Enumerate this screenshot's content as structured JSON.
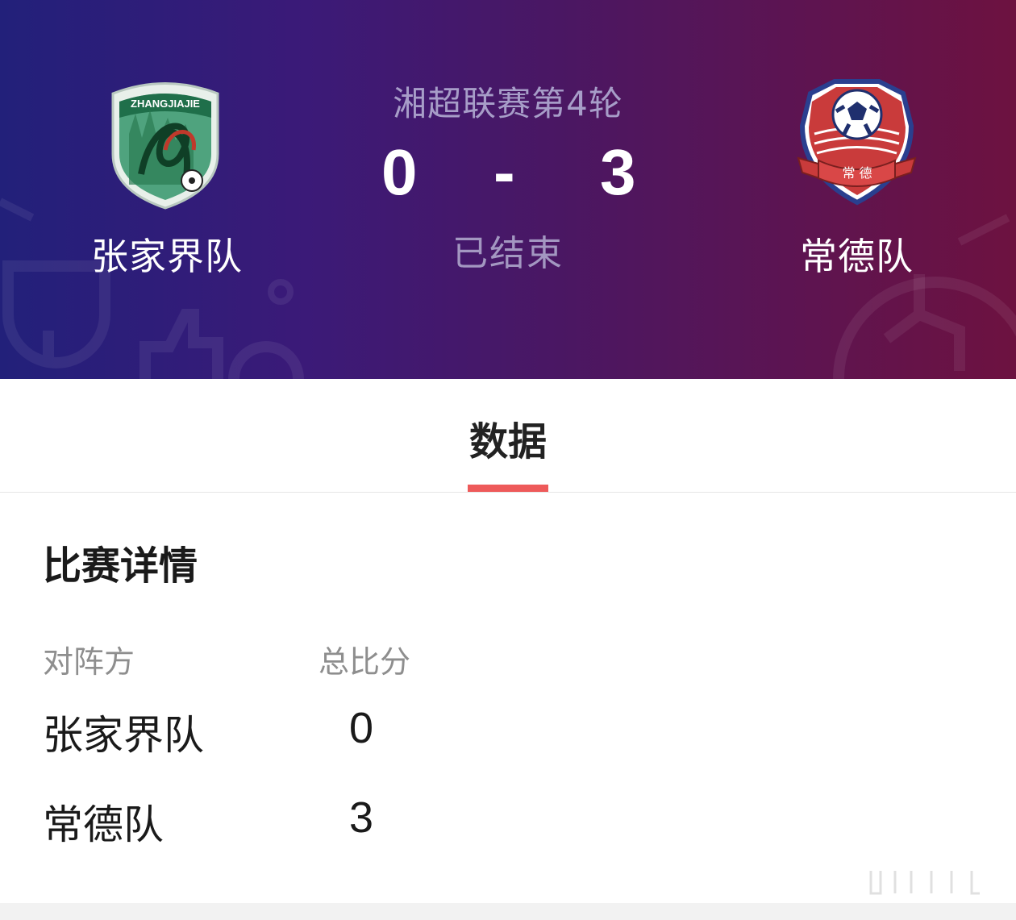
{
  "match": {
    "round": "湘超联赛第4轮",
    "status": "已结束",
    "home": {
      "name": "张家界队",
      "score": "0",
      "logo_text": "ZHANGJIAJIE",
      "logo_icon": "zhangjiajie-crest-icon"
    },
    "away": {
      "name": "常德队",
      "score": "3",
      "logo_text": "常 德",
      "logo_icon": "changde-crest-icon"
    },
    "separator": "-"
  },
  "tabs": [
    {
      "label": "数据",
      "active": true
    }
  ],
  "details": {
    "title": "比赛详情",
    "headers": {
      "team": "对阵方",
      "total": "总比分"
    },
    "rows": [
      {
        "team": "张家界队",
        "total": "0"
      },
      {
        "team": "常德队",
        "total": "3"
      }
    ]
  },
  "colors": {
    "hero_gradient": [
      "#22207a",
      "#3b1a78",
      "#4a1763",
      "#5e1450",
      "#6d1240"
    ],
    "tab_indicator": "#ee5a5a",
    "heading": "#1a1a1a",
    "muted": "#8e8e8e"
  }
}
